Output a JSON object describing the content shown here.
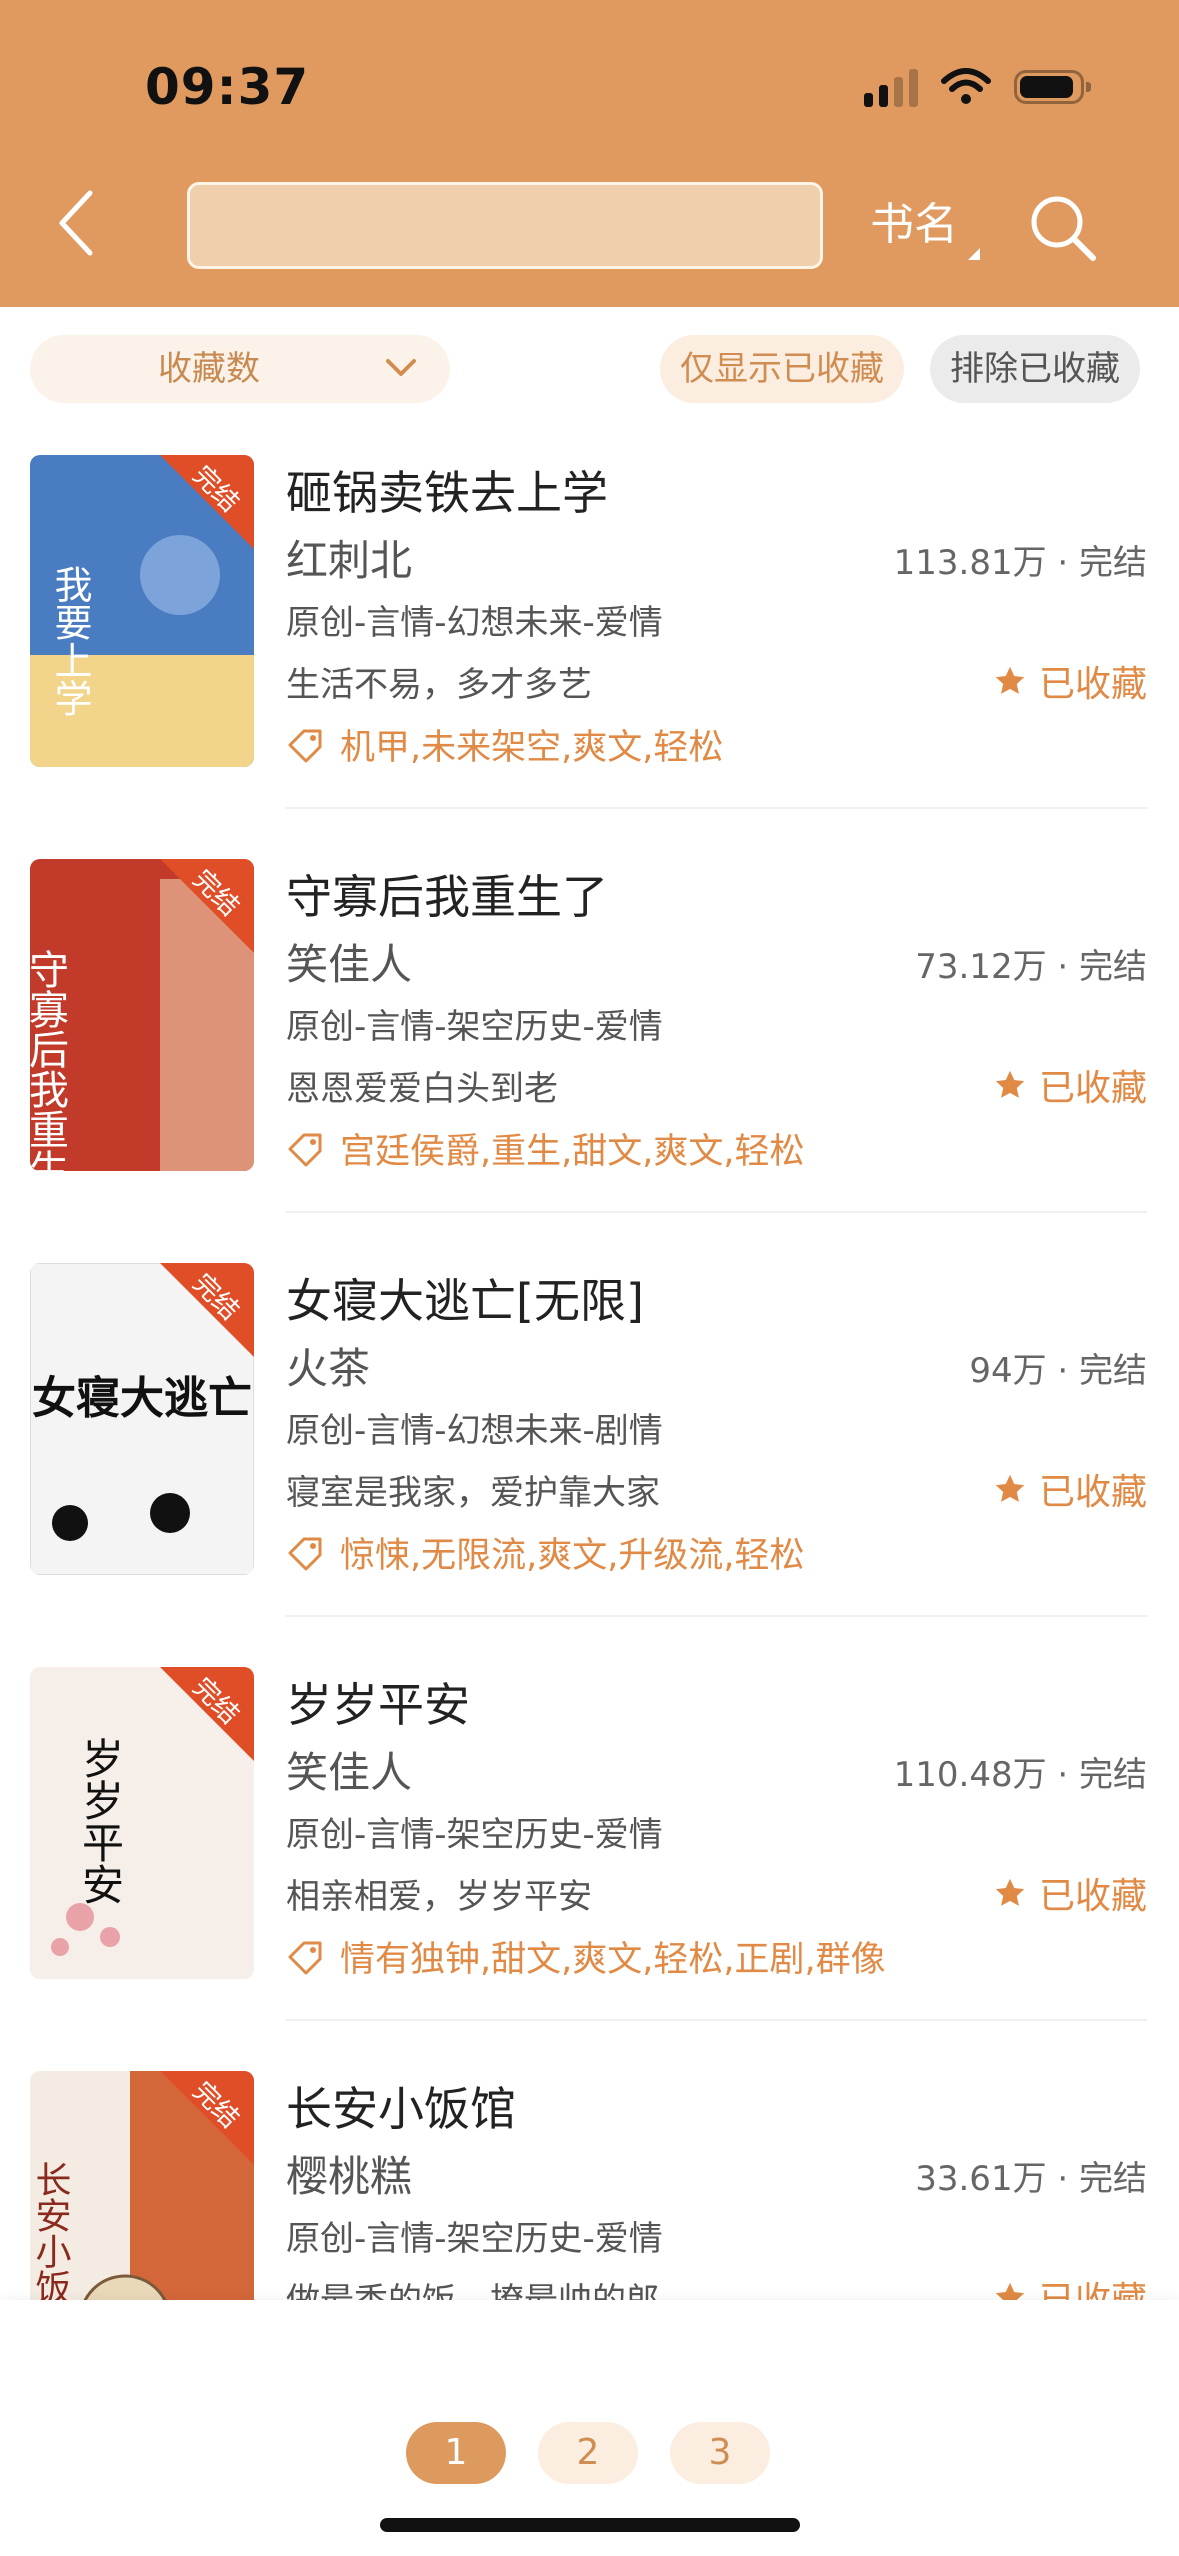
{
  "status": {
    "time": "09:37"
  },
  "header": {
    "search_value": "",
    "search_type": "书名"
  },
  "filters": {
    "sort_label": "收藏数",
    "only_saved": "仅显示已收藏",
    "exclude_saved": "排除已收藏"
  },
  "books": [
    {
      "title": "砸锅卖铁去上学",
      "author": "红刺北",
      "count": "113.81万 · 完结",
      "category": "原创-言情-幻想未来-爱情",
      "blurb": "生活不易，多才多艺",
      "fav": "已收藏",
      "tags": "机甲,未来架空,爽文,轻松",
      "badge": "完结",
      "cover_text": "我要上学",
      "cover_color": "#3f6fb6"
    },
    {
      "title": "守寡后我重生了",
      "author": "笑佳人",
      "count": "73.12万 · 完结",
      "category": "原创-言情-架空历史-爱情",
      "blurb": "恩恩爱爱白头到老",
      "fav": "已收藏",
      "tags": "宫廷侯爵,重生,甜文,爽文,轻松",
      "badge": "完结",
      "cover_text": "守寡后我重生了",
      "cover_color": "#c23a2a"
    },
    {
      "title": "女寝大逃亡[无限]",
      "author": "火茶",
      "count": "94万 · 完结",
      "category": "原创-言情-幻想未来-剧情",
      "blurb": "寝室是我家，爱护靠大家",
      "fav": "已收藏",
      "tags": "惊悚,无限流,爽文,升级流,轻松",
      "badge": "完结",
      "cover_text": "女寝大逃亡",
      "cover_color": "#f3f3f3"
    },
    {
      "title": "岁岁平安",
      "author": "笑佳人",
      "count": "110.48万 · 完结",
      "category": "原创-言情-架空历史-爱情",
      "blurb": "相亲相爱，岁岁平安",
      "fav": "已收藏",
      "tags": "情有独钟,甜文,爽文,轻松,正剧,群像",
      "badge": "完结",
      "cover_text": "岁岁平安",
      "cover_color": "#f4ece6"
    },
    {
      "title": "长安小饭馆",
      "author": "樱桃糕",
      "count": "33.61万 · 完结",
      "category": "原创-言情-架空历史-爱情",
      "blurb": "做最香的饭，撩最帅的郎",
      "fav": "已收藏",
      "tags": "",
      "badge": "完结",
      "cover_text": "长安小饭馆",
      "cover_color": "#d4673a"
    }
  ],
  "pagination": [
    "1",
    "2",
    "3"
  ]
}
